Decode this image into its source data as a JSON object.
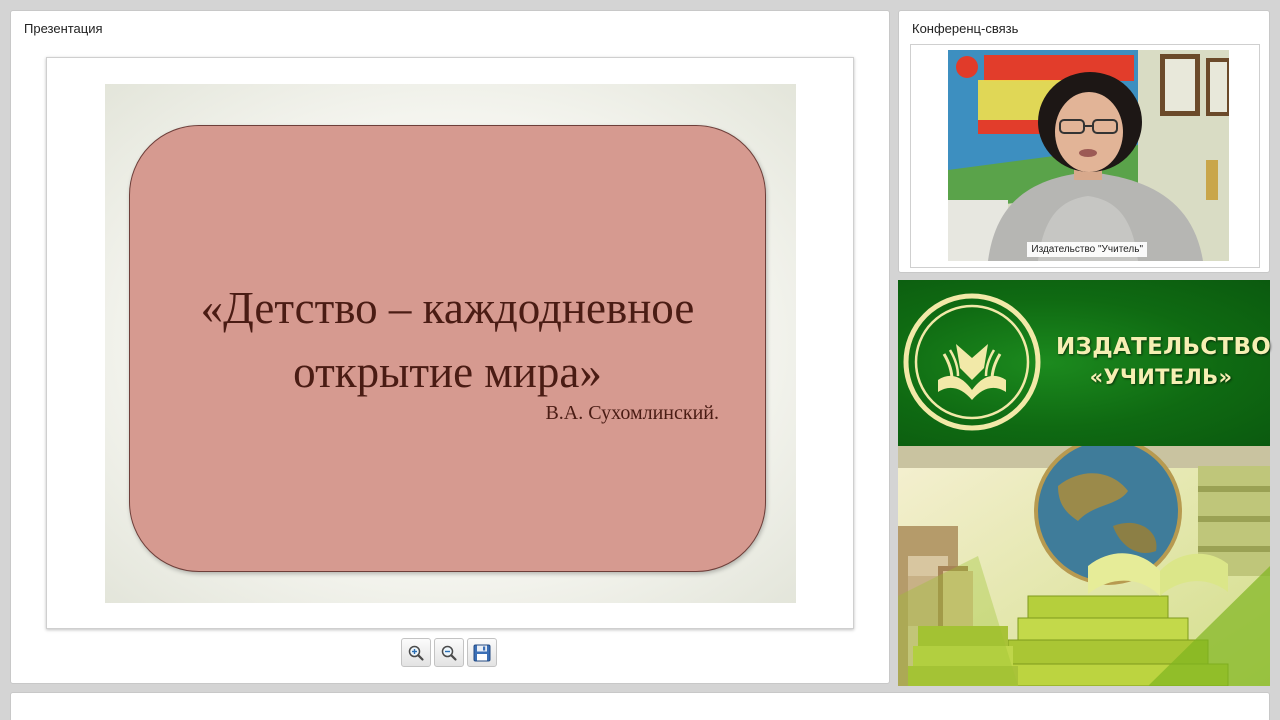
{
  "presentation": {
    "title": "Презентация",
    "slide": {
      "quote_line1": "«Детство – каждодневное",
      "quote_line2": "открытие мира»",
      "author": "В.А. Сухомлинский."
    },
    "toolbar": {
      "zoom_in_icon": "zoom-in-icon",
      "zoom_out_icon": "zoom-out-icon",
      "save_icon": "floppy-disk-icon"
    }
  },
  "conference": {
    "title": "Конференц-связь",
    "video_caption": "Издательство \"Учитель\""
  },
  "banner": {
    "name_line1": "ИЗДАТЕЛЬСТВО",
    "name_line2": "«УЧИТЕЛЬ»"
  },
  "colors": {
    "slide_card": "#d69a90",
    "slide_text": "#4a1c14",
    "banner_green": "#0f6a12",
    "brand_text": "#f6efb3"
  }
}
